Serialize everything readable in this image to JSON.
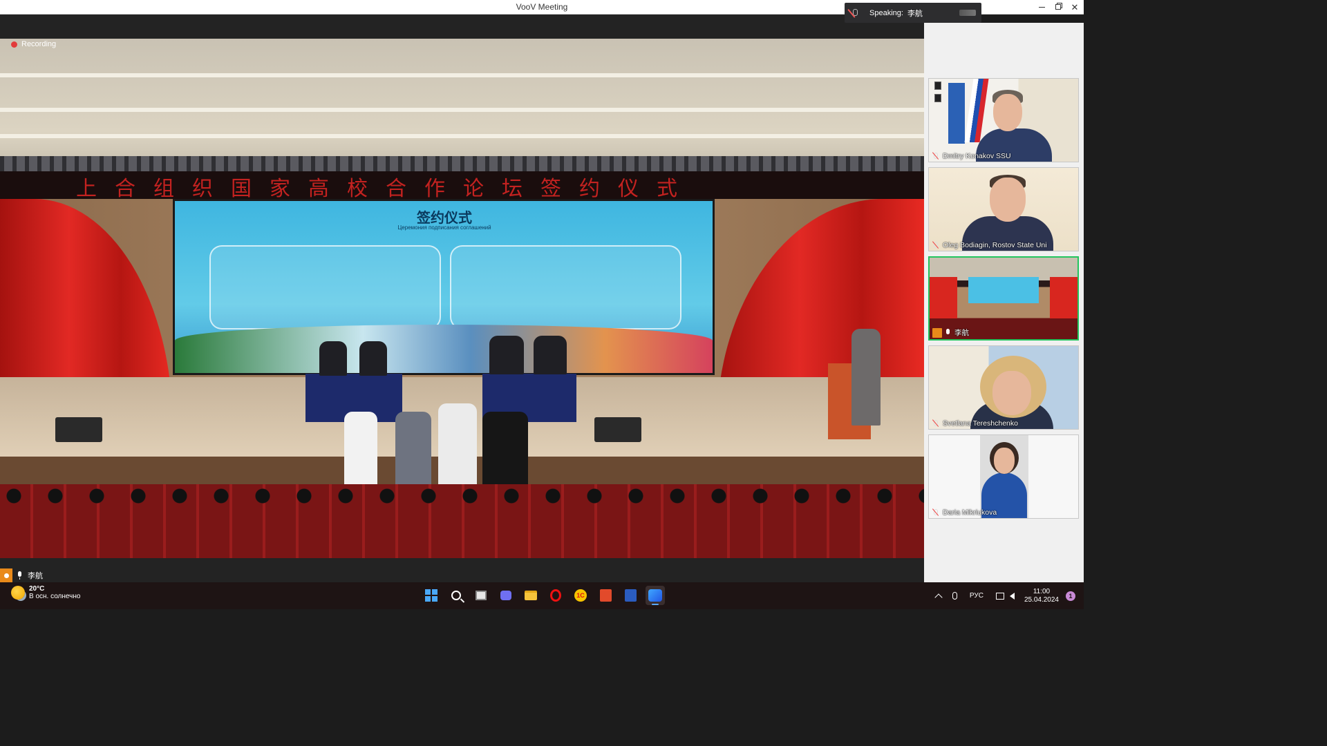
{
  "window": {
    "title": "VooV Meeting"
  },
  "speaking": {
    "label": "Speaking:",
    "name": "李航"
  },
  "recording": {
    "label": "Recording",
    "color": "#e23b3b"
  },
  "main_video": {
    "banner_text": "上合组织国家高校合作论坛签约仪式",
    "screen_title": "签约仪式",
    "screen_subtitle": "Церемония подписания соглашений",
    "presenter_name": "李航"
  },
  "participants": [
    {
      "name": "Dmitry Konakov SSU",
      "mic": "muted",
      "active": false
    },
    {
      "name": "Oleg Bodiagin, Rostov State Uni",
      "mic": "muted",
      "active": false
    },
    {
      "name": "李航",
      "mic": "on",
      "host": true,
      "active": true
    },
    {
      "name": "Svetlana Tereshchenko",
      "mic": "muted",
      "active": false
    },
    {
      "name": "Daria Mikriukova",
      "mic": "muted",
      "active": false
    }
  ],
  "taskbar": {
    "weather_temp": "20°C",
    "weather_desc": "В осн. солнечно",
    "apps": [
      "start-icon",
      "search-icon",
      "task-view-icon",
      "chat-icon",
      "file-explorer-icon",
      "opera-icon",
      "1c-icon",
      "pdf-icon",
      "word-icon",
      "voov-meeting-icon"
    ],
    "lang": "РУС",
    "time": "11:00",
    "date": "25.04.2024",
    "notification_count": "1"
  },
  "colors": {
    "active_border": "#22c55e",
    "host_badge": "#e98a1a",
    "accent": "#4aa8f8"
  }
}
